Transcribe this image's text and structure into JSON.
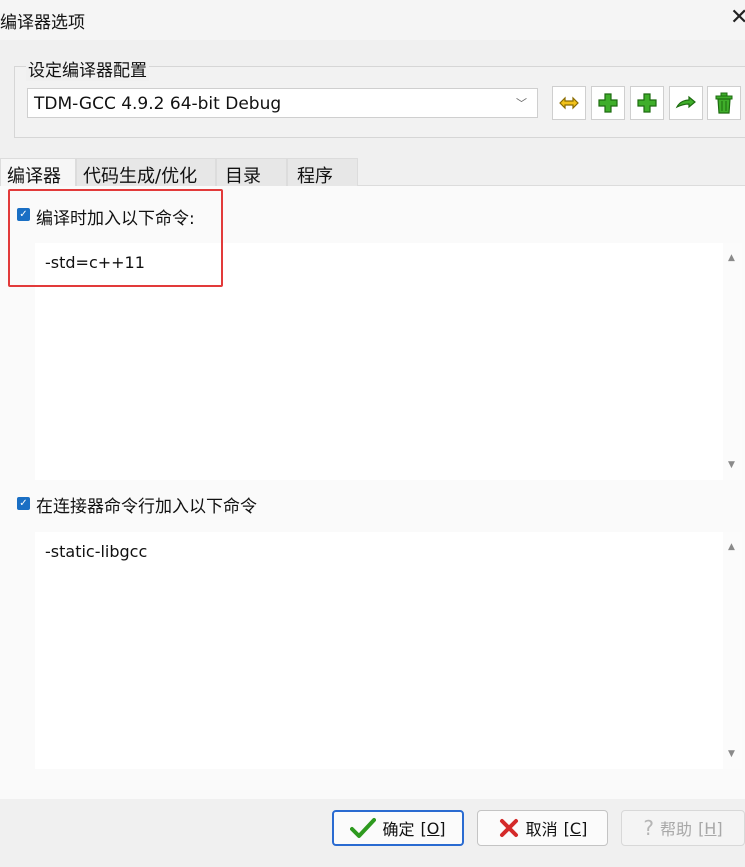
{
  "window": {
    "title": "编译器选项"
  },
  "config_group": {
    "label": "设定编译器配置",
    "selected": "TDM-GCC 4.9.2 64-bit Debug"
  },
  "tabs": [
    {
      "label": "编译器",
      "active": true
    },
    {
      "label": "代码生成/优化",
      "active": false
    },
    {
      "label": "目录",
      "active": false
    },
    {
      "label": "程序",
      "active": false
    }
  ],
  "compiler_section": {
    "checkbox_label": "编译时加入以下命令:",
    "checked": true,
    "value": "-std=c++11"
  },
  "linker_section": {
    "checkbox_label": "在连接器命令行加入以下命令",
    "checked": true,
    "value": "-static-libgcc"
  },
  "buttons": {
    "ok": {
      "text": "确定",
      "shortcut": "[O]"
    },
    "cancel": {
      "text": "取消",
      "shortcut": "[C]"
    },
    "help": {
      "text": "帮助",
      "shortcut": "[H]"
    }
  },
  "colors": {
    "accent": "#1a6fc4",
    "highlight": "#e23a3a"
  },
  "icons": [
    "rename-icon",
    "add-icon",
    "add-icon",
    "copy-icon",
    "delete-icon"
  ]
}
